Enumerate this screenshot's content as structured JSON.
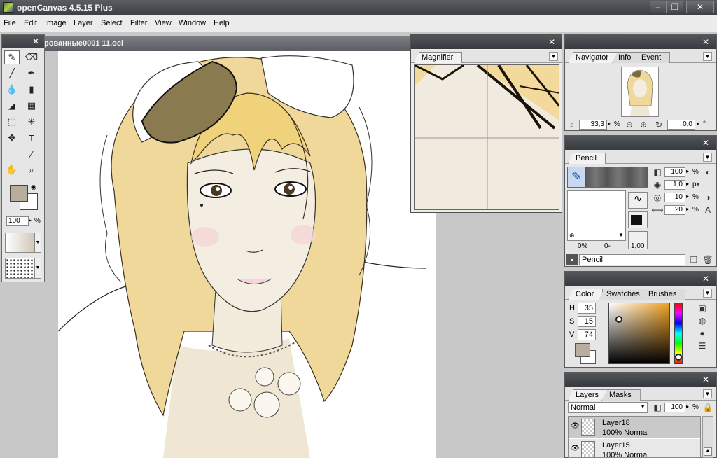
{
  "app": {
    "title": "openCanvas 4.5.15 Plus"
  },
  "window_controls": {
    "minimize": "‒",
    "maximize": "❐",
    "close": "✕"
  },
  "menu": [
    "File",
    "Edit",
    "Image",
    "Layer",
    "Select",
    "Filter",
    "View",
    "Window",
    "Help"
  ],
  "document": {
    "title": "рованные0001 11.oci"
  },
  "toolbox": {
    "opacity_value": "100",
    "opacity_unit": "%",
    "primary_color": "#b9ad9d",
    "secondary_color": "#ffffff"
  },
  "magnifier": {
    "tab": "Magnifier"
  },
  "navigator": {
    "tabs": [
      "Navigator",
      "Info",
      "Event"
    ],
    "zoom_value": "33,3",
    "zoom_unit": "%",
    "rotation_value": "0,0",
    "rotation_unit": "°"
  },
  "pencil": {
    "tab": "Pencil",
    "opacity": "100",
    "opacity_unit": "%",
    "size": "1,0",
    "size_unit": "px",
    "density": "10",
    "density_unit": "%",
    "hardness": "20",
    "hardness_unit": "%",
    "texture_percent": "0%",
    "texture_value": "0-",
    "ratio": "1,00",
    "preset_name": "Pencil"
  },
  "color": {
    "tabs": [
      "Color",
      "Swatches",
      "Brushes"
    ],
    "h_label": "H",
    "h_value": "35",
    "s_label": "S",
    "s_value": "15",
    "v_label": "V",
    "v_value": "74",
    "current_color": "#b9ad9d",
    "hue_color": "#f0a020"
  },
  "layers": {
    "tabs": [
      "Layers",
      "Masks"
    ],
    "blend_mode": "Normal",
    "opacity": "100",
    "opacity_unit": "%",
    "items": [
      {
        "name": "Layer18",
        "info": "100% Normal"
      },
      {
        "name": "Layer15",
        "info": "100% Normal"
      }
    ]
  }
}
